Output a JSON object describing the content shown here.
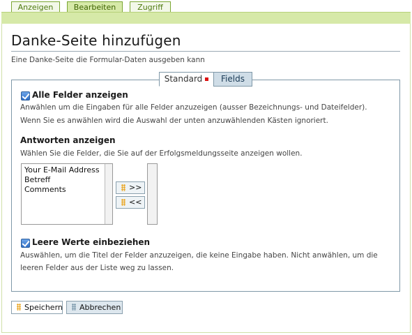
{
  "tabs": {
    "view": "Anzeigen",
    "edit": "Bearbeiten",
    "access": "Zugriff",
    "active": "edit"
  },
  "page": {
    "title": "Danke-Seite hinzufügen",
    "description": "Eine Danke-Seite die Formular-Daten ausgeben kann"
  },
  "inner_tabs": {
    "standard": "Standard",
    "fields": "Fields",
    "active": "fields"
  },
  "show_all": {
    "checked": true,
    "label": "Alle Felder anzeigen",
    "desc_line1": "Anwählen um die Eingaben für alle Felder anzuzeigen (ausser Bezeichnungs- und Dateifelder).",
    "desc_line2": "Wenn Sie es anwählen wird die Auswahl der unten anzuwählenden Kästen ignoriert."
  },
  "answers": {
    "label": "Antworten anzeigen",
    "desc": "Wählen Sie die Felder, die Sie auf der Erfolgsmeldungsseite anzeigen wollen.",
    "available": [
      "Your E-Mail Address",
      "Betreff",
      "Comments"
    ],
    "selected": [],
    "add_label": ">>",
    "remove_label": "<<"
  },
  "empty_values": {
    "checked": true,
    "label": "Leere Werte einbeziehen",
    "desc_line1": "Auswählen, um die Titel der Felder anzuzeigen, die keine Eingabe haben. Nicht anwählen, um die",
    "desc_line2": "leeren Felder aus der Liste weg zu lassen."
  },
  "buttons": {
    "save": "Speichern",
    "cancel": "Abbrechen"
  },
  "colors": {
    "accent_green": "#d6e9a8",
    "tab_text_green": "#4e7a0f",
    "indicator_red": "#dd1111"
  }
}
